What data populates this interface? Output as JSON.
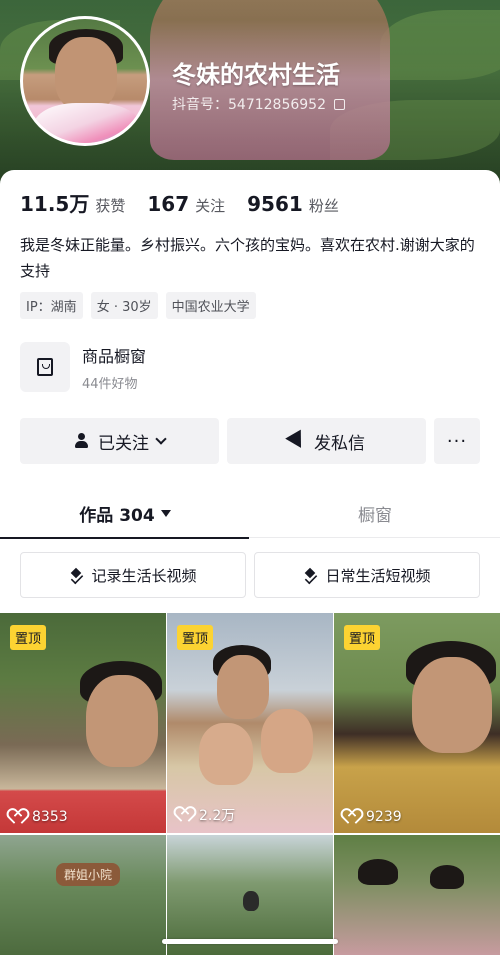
{
  "profile": {
    "name": "冬妹的农村生活",
    "douyin_id": "抖音号：54712856952"
  },
  "stats": [
    {
      "value": "11.5万",
      "label": "获赞"
    },
    {
      "value": "167",
      "label": "关注"
    },
    {
      "value": "9561",
      "label": "粉丝"
    }
  ],
  "bio": "我是冬妹正能量。乡村振兴。六个孩的宝妈。喜欢在农村.谢谢大家的支持",
  "tags": [
    "IP：湖南",
    "女 · 30岁",
    "中国农业大学"
  ],
  "shop": {
    "title": "商品橱窗",
    "subtitle": "44件好物",
    "icon": "shopping-bag-icon"
  },
  "actions": {
    "follow_label": "已关注",
    "message_label": "发私信",
    "more_label": "···"
  },
  "tabs": [
    {
      "label": "作品 304",
      "active": true
    },
    {
      "label": "橱窗",
      "active": false
    }
  ],
  "collections": [
    "记录生活长视频",
    "日常生活短视频"
  ],
  "videos": [
    {
      "pinned": "置顶",
      "likes": "8353",
      "sign": ""
    },
    {
      "pinned": "置顶",
      "likes": "2.2万",
      "sign": ""
    },
    {
      "pinned": "置顶",
      "likes": "9239",
      "sign": ""
    },
    {
      "pinned": "",
      "likes": "",
      "sign": "群姐小院"
    },
    {
      "pinned": "",
      "likes": "",
      "sign": ""
    },
    {
      "pinned": "",
      "likes": "",
      "sign": ""
    }
  ],
  "colors": {
    "text": "#161823",
    "secondary": "#57585f",
    "button_bg": "#f2f2f4",
    "pin_badge": "#fcd332"
  }
}
